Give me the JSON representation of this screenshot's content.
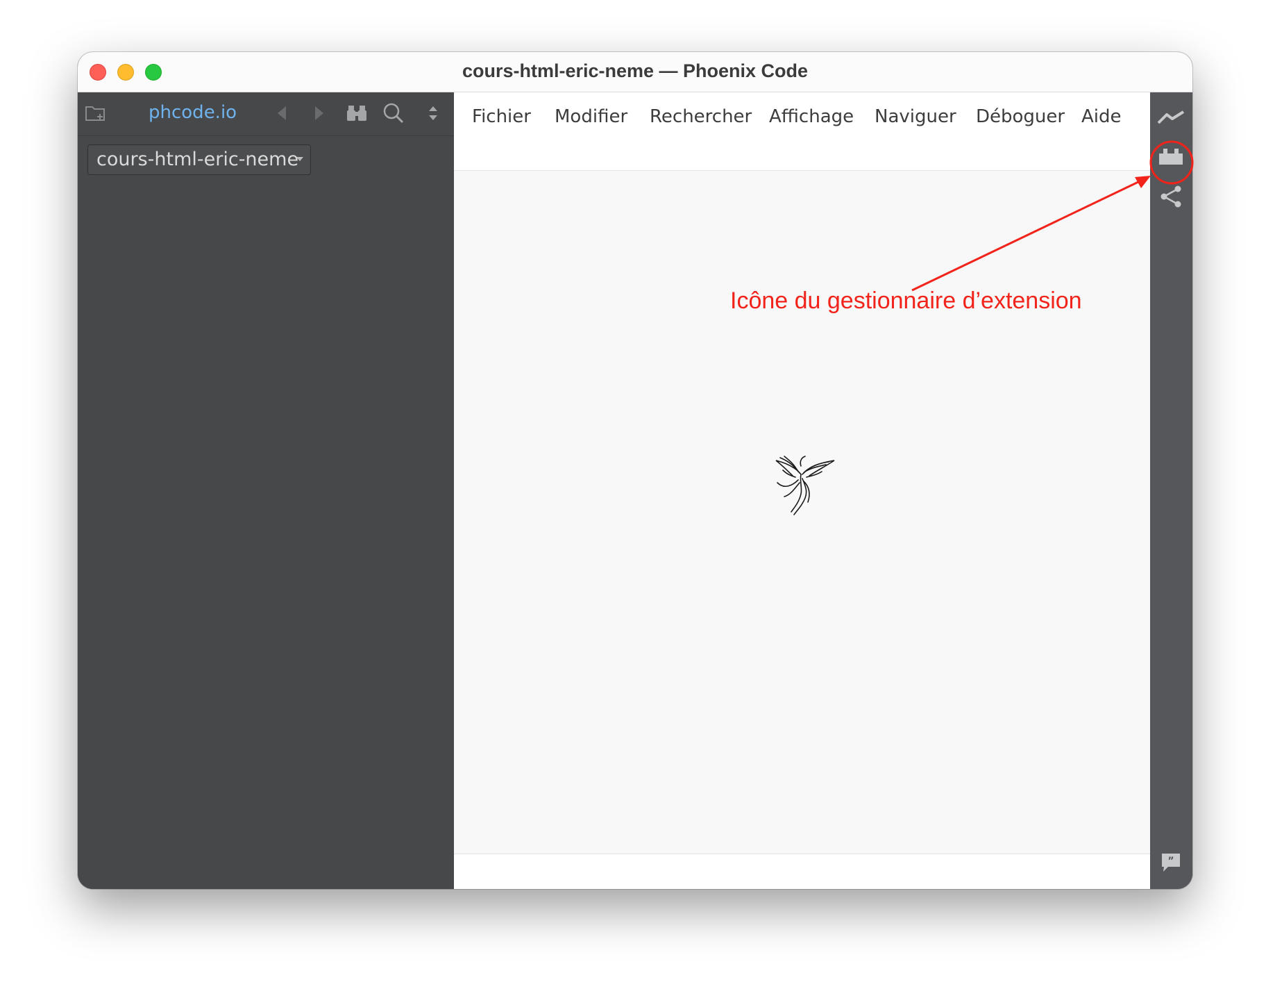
{
  "window": {
    "title": "cours-html-eric-neme — Phoenix Code"
  },
  "sidebar": {
    "brand": "phcode.io",
    "project": "cours-html-eric-neme",
    "toolbar_icons": [
      "new-folder-icon",
      "back-arrow-icon",
      "forward-arrow-icon",
      "binoculars-icon",
      "search-icon",
      "collapse-expand-icon"
    ]
  },
  "menubar": {
    "items": [
      {
        "label": "Fichier"
      },
      {
        "label": "Modifier"
      },
      {
        "label": "Rechercher"
      },
      {
        "label": "Affichage"
      },
      {
        "label": "Naviguer"
      },
      {
        "label": "Déboguer"
      },
      {
        "label": "Aide"
      }
    ]
  },
  "right_toolbar": {
    "icons": [
      "live-preview-icon",
      "extension-manager-icon",
      "share-icon",
      "feedback-icon"
    ]
  },
  "annotation": {
    "text": "Icône du gestionnaire d’extension",
    "color": "#f2231b"
  },
  "colors": {
    "sidebar_bg": "#47484a",
    "brand_blue": "#6fb3ee",
    "annotation_red": "#f2231b"
  }
}
